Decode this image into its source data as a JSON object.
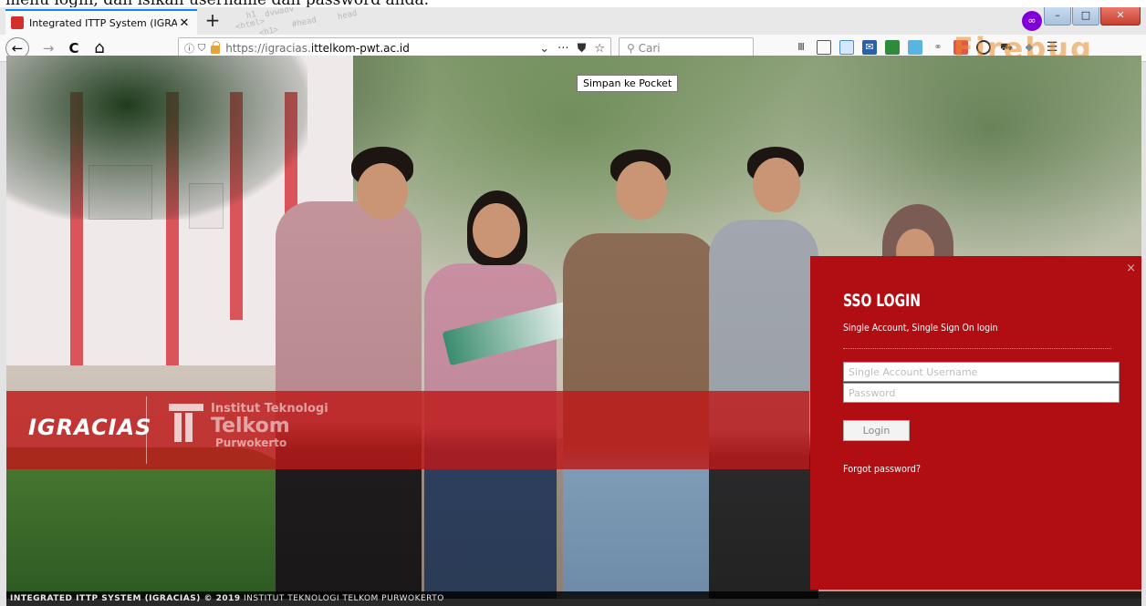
{
  "doc_caption": "menu login, dan isikan username dan password anda.",
  "browser": {
    "tab_title": "Integrated ITTP System (IGRAC",
    "tab_close": "✕",
    "new_tab": "+",
    "profile_glyph": "∞",
    "win_minimize": "–",
    "win_maximize": "□",
    "win_close": "✕",
    "url_prefix": "https://igracias.",
    "url_host": "ittelkom-pwt.ac.id",
    "search_placeholder": "Cari",
    "tooltip": "Simpan ke Pocket",
    "watermark": "Firebug",
    "nav_back": "←",
    "nav_forward": "→",
    "nav_reload": "C",
    "nav_home": "⌂",
    "deco": [
      "h1",
      "dvwadv",
      "<html>",
      "#head",
      "<h1>",
      "head"
    ]
  },
  "brand": {
    "logo": "IGRACIAS",
    "inst_line1": "Institut Teknologi",
    "inst_line2": "Telkom",
    "inst_line3": "Purwokerto"
  },
  "login": {
    "close": "×",
    "title": "SSO LOGIN",
    "subtitle": "Single Account, Single Sign On login",
    "username_placeholder": "Single Account Username",
    "password_placeholder": "Password",
    "button": "Login",
    "forgot": "Forgot password?"
  },
  "footer": {
    "bold": "INTEGRATED ITTP SYSTEM (IGRACIAS) © 2019",
    "rest": " INSTITUT TEKNOLOGI TELKOM PURWOKERTO"
  },
  "colors": {
    "login_panel": "#b10e13",
    "brand_band": "#be1818",
    "tab_accent": "#0a84ff"
  }
}
